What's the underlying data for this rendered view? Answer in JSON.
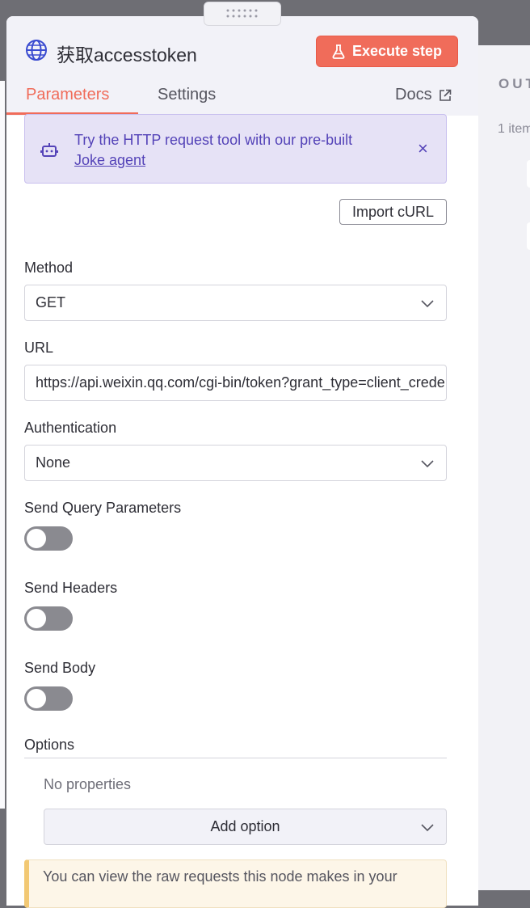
{
  "node": {
    "title": "获取accesstoken",
    "execute_label": "Execute step"
  },
  "tabs": {
    "parameters": "Parameters",
    "settings": "Settings",
    "docs": "Docs"
  },
  "callout": {
    "text": "Try the HTTP request tool with our pre-built",
    "link": "Joke agent",
    "close": "×"
  },
  "import_curl": "Import cURL",
  "method": {
    "label": "Method",
    "value": "GET"
  },
  "url": {
    "label": "URL",
    "value": "https://api.weixin.qq.com/cgi-bin/token?grant_type=client_credential"
  },
  "authentication": {
    "label": "Authentication",
    "value": "None"
  },
  "send_query_parameters": {
    "label": "Send Query Parameters",
    "on": false
  },
  "send_headers": {
    "label": "Send Headers",
    "on": false
  },
  "send_body": {
    "label": "Send Body",
    "on": false
  },
  "options": {
    "label": "Options",
    "empty": "No properties",
    "add_label": "Add option"
  },
  "notice": "You can view the raw requests this node makes in your",
  "output": {
    "title": "OUT",
    "items": "1 item"
  },
  "colors": {
    "accent": "#f06c5a",
    "callout_bg": "#e6e2f6",
    "callout_text": "#5443b8"
  }
}
